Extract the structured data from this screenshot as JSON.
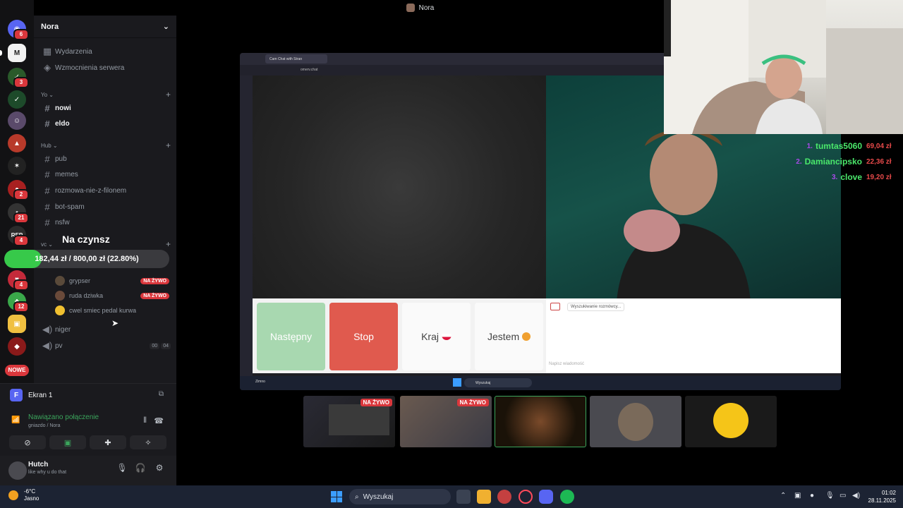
{
  "window": {
    "title": "Nora"
  },
  "sidebar": {
    "server_name": "Nora",
    "top_items": [
      {
        "icon": "calendar-icon",
        "label": "Wydarzenia"
      },
      {
        "icon": "boost-icon",
        "label": "Wzmocnienia serwera"
      }
    ],
    "categories": [
      {
        "name": "Yo",
        "channels": [
          {
            "label": "nowi",
            "unread": true
          },
          {
            "label": "eldo",
            "unread": true
          }
        ]
      },
      {
        "name": "Hub",
        "channels": [
          {
            "label": "pub",
            "unread": false
          },
          {
            "label": "memes",
            "unread": false
          },
          {
            "label": "rozmowa-nie-z-filonem",
            "unread": false
          },
          {
            "label": "bot-spam",
            "unread": false
          },
          {
            "label": "nsfw",
            "unread": false
          }
        ]
      },
      {
        "name": "vc"
      }
    ],
    "voice_users": [
      {
        "name": "grypser",
        "live": "NA ŻYWO"
      },
      {
        "name": "ruda dziwka",
        "live": "NA ŻYWO"
      },
      {
        "name": "cwel smiec pedal kurwa",
        "live": ""
      }
    ],
    "voice_channels": [
      {
        "label": "niger",
        "counts": ""
      },
      {
        "label": "pv",
        "counts_a": "00",
        "counts_b": "04"
      }
    ],
    "server_badges": [
      "6",
      "3",
      "2",
      "21",
      "4",
      "4",
      "12"
    ],
    "new_label": "NOWE"
  },
  "goal": {
    "title": "Na czynsz",
    "current": "182,44 zł",
    "target": "800,00 zł",
    "text": "182,44 zł / 800,00 zł (22.80%)",
    "fraction": 0.228
  },
  "connection": {
    "screen_label": "Ekran 1",
    "status": "Nawiązano połączenie",
    "sub": "gniazdo / Nora"
  },
  "user": {
    "name": "Hutch",
    "status": "like why u do that"
  },
  "stream": {
    "tab_title": "Cam Chat with Stran",
    "url": "omerv.chat",
    "buttons": {
      "next": "Następny",
      "stop": "Stop",
      "country": "Kraj",
      "gender": "Jestem"
    },
    "searching": "Wyszukiwanie rozmówcy...",
    "input_placeholder": "Napisz wiadomość",
    "inner_weather": "Zimno",
    "inner_search": "Wyszukaj"
  },
  "donors": [
    {
      "rank": "1.",
      "name": "tumtas5060",
      "amount": "69,04 zł"
    },
    {
      "rank": "2.",
      "name": "Damiancipsko",
      "amount": "22,36 zł"
    },
    {
      "rank": "3.",
      "name": "clove",
      "amount": "19,20 zł"
    }
  ],
  "thumbnails": [
    {
      "live": "NA ŻYWO"
    },
    {
      "live": "NA ŻYWO"
    },
    {
      "live": ""
    },
    {
      "live": ""
    },
    {
      "live": ""
    }
  ],
  "taskbar": {
    "temp": "-6°C",
    "weather": "Jasno",
    "search": "Wyszukaj",
    "time": "01:02",
    "date": "28.11.2025"
  },
  "colors": {
    "accent": "#5865f2",
    "live": "#da373c",
    "goal": "#37c94a",
    "stop": "#e05a4e",
    "next": "#a8d8b0"
  }
}
